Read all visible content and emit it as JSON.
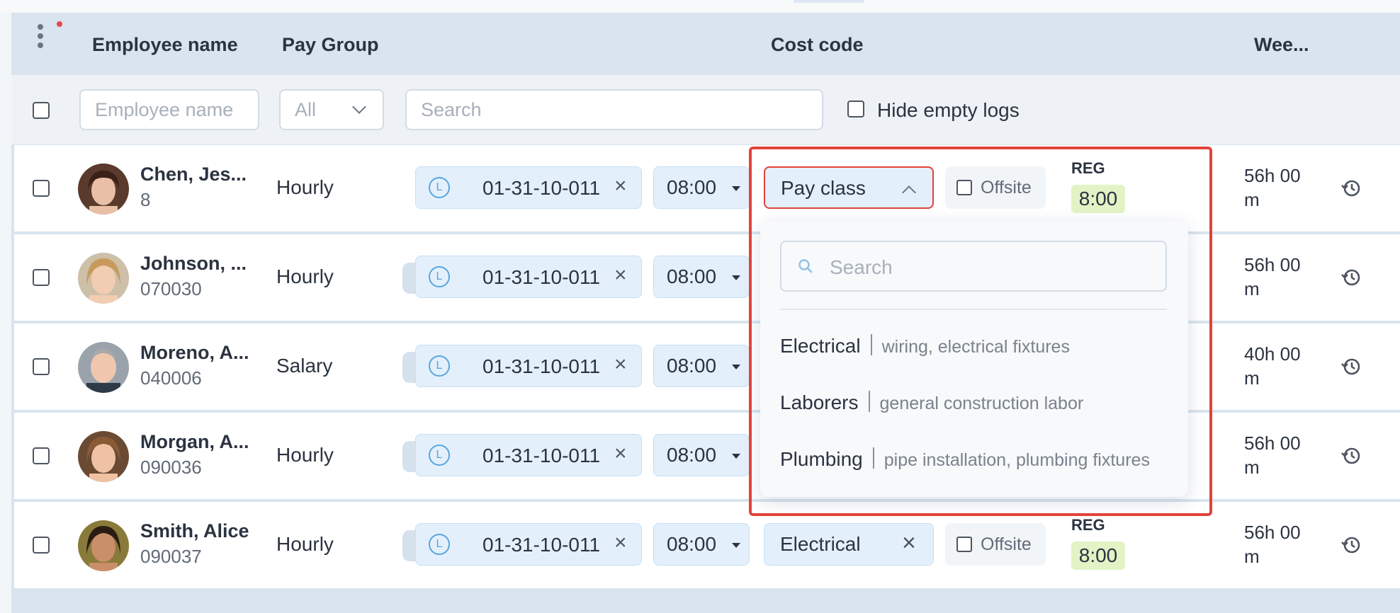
{
  "header": {
    "columns": {
      "employee_name": "Employee name",
      "pay_group": "Pay Group",
      "cost_code": "Cost code",
      "week": "Wee..."
    }
  },
  "filters": {
    "employee_placeholder": "Employee name",
    "paygroup_value": "All",
    "search_placeholder": "Search",
    "hide_empty_label": "Hide empty logs"
  },
  "rows": [
    {
      "name": "Chen, Jes...",
      "id": "8",
      "pay_group": "Hourly",
      "cost_code": "01-31-10-011",
      "code_icon": "L",
      "time": "08:00",
      "pay_class": "Pay class",
      "offsite": "Offsite",
      "reg_label": "REG",
      "reg_value": "8:00",
      "week_line1": "56h 00",
      "week_line2": "m"
    },
    {
      "name": "Johnson, ...",
      "id": "070030",
      "pay_group": "Hourly",
      "cost_code": "01-31-10-011",
      "code_icon": "L",
      "time": "08:00",
      "week_line1": "56h 00",
      "week_line2": "m"
    },
    {
      "name": "Moreno, A...",
      "id": "040006",
      "pay_group": "Salary",
      "cost_code": "01-31-10-011",
      "code_icon": "L",
      "time": "08:00",
      "week_line1": "40h 00",
      "week_line2": "m"
    },
    {
      "name": "Morgan, A...",
      "id": "090036",
      "pay_group": "Hourly",
      "cost_code": "01-31-10-011",
      "code_icon": "L",
      "time": "08:00",
      "week_line1": "56h 00",
      "week_line2": "m"
    },
    {
      "name": "Smith, Alice",
      "id": "090037",
      "pay_group": "Hourly",
      "cost_code": "01-31-10-011",
      "code_icon": "L",
      "time": "08:00",
      "pay_class": "Electrical",
      "offsite": "Offsite",
      "reg_label": "REG",
      "reg_value": "8:00",
      "week_line1": "56h 00",
      "week_line2": "m"
    }
  ],
  "dropdown": {
    "search_placeholder": "Search",
    "options": [
      {
        "name": "Electrical",
        "desc": "wiring, electrical fixtures"
      },
      {
        "name": "Laborers",
        "desc": "general construction labor"
      },
      {
        "name": "Plumbing",
        "desc": "pipe installation, plumbing fixtures"
      }
    ]
  },
  "colors": {
    "accent_red": "#e0443a",
    "chip_blue": "#e3f0fb",
    "reg_green": "#e2f3c6",
    "header_bg": "#d9e4ee"
  },
  "icons": [
    "kebab-menu-icon",
    "notification-dot-icon",
    "chevron-down-icon",
    "chevron-up-icon",
    "close-icon",
    "history-icon",
    "search-icon",
    "labor-code-icon"
  ]
}
